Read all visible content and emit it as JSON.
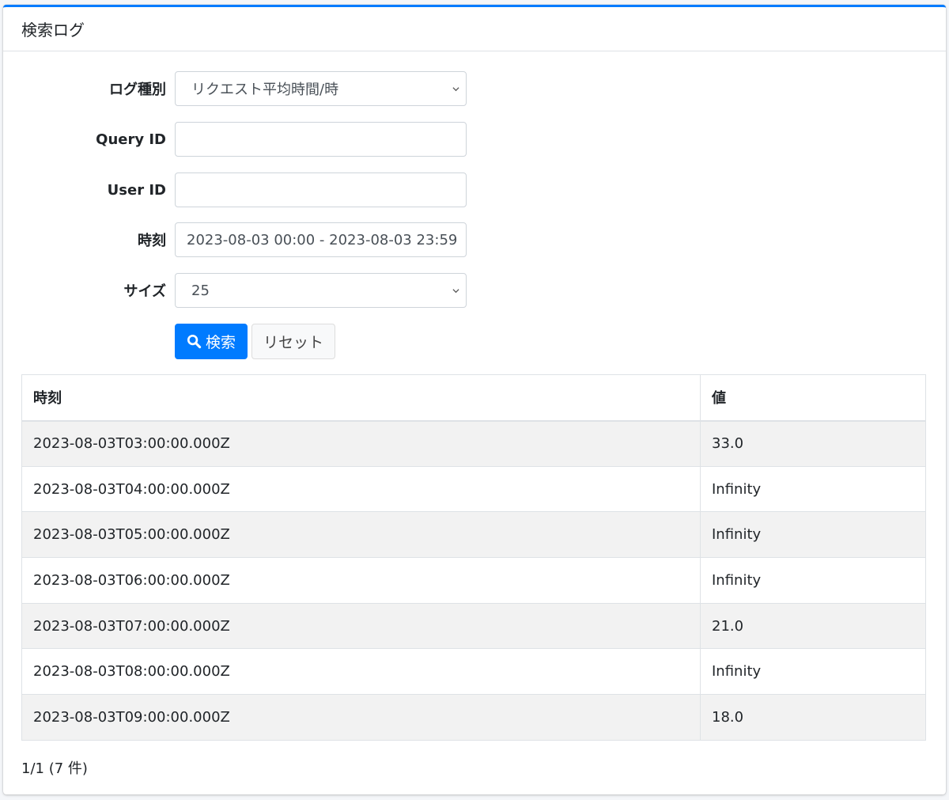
{
  "card": {
    "title": "検索ログ"
  },
  "form": {
    "log_type": {
      "label": "ログ種別",
      "value": "リクエスト平均時間/時"
    },
    "query_id": {
      "label": "Query ID",
      "value": ""
    },
    "user_id": {
      "label": "User ID",
      "value": ""
    },
    "time_range": {
      "label": "時刻",
      "value": "2023-08-03 00:00 - 2023-08-03 23:59"
    },
    "size": {
      "label": "サイズ",
      "value": "25"
    },
    "search_button": {
      "label": "検索",
      "icon": "search-icon"
    },
    "reset_button": {
      "label": "リセット"
    }
  },
  "table": {
    "headers": [
      "時刻",
      "値"
    ],
    "rows": [
      [
        "2023-08-03T03:00:00.000Z",
        "33.0"
      ],
      [
        "2023-08-03T04:00:00.000Z",
        "Infinity"
      ],
      [
        "2023-08-03T05:00:00.000Z",
        "Infinity"
      ],
      [
        "2023-08-03T06:00:00.000Z",
        "Infinity"
      ],
      [
        "2023-08-03T07:00:00.000Z",
        "21.0"
      ],
      [
        "2023-08-03T08:00:00.000Z",
        "Infinity"
      ],
      [
        "2023-08-03T09:00:00.000Z",
        "18.0"
      ]
    ]
  },
  "pagination": {
    "text": "1/1 (7 件)"
  },
  "colors": {
    "accent": "#007bff",
    "stripe": "#f2f2f2",
    "border": "#dee2e6"
  }
}
